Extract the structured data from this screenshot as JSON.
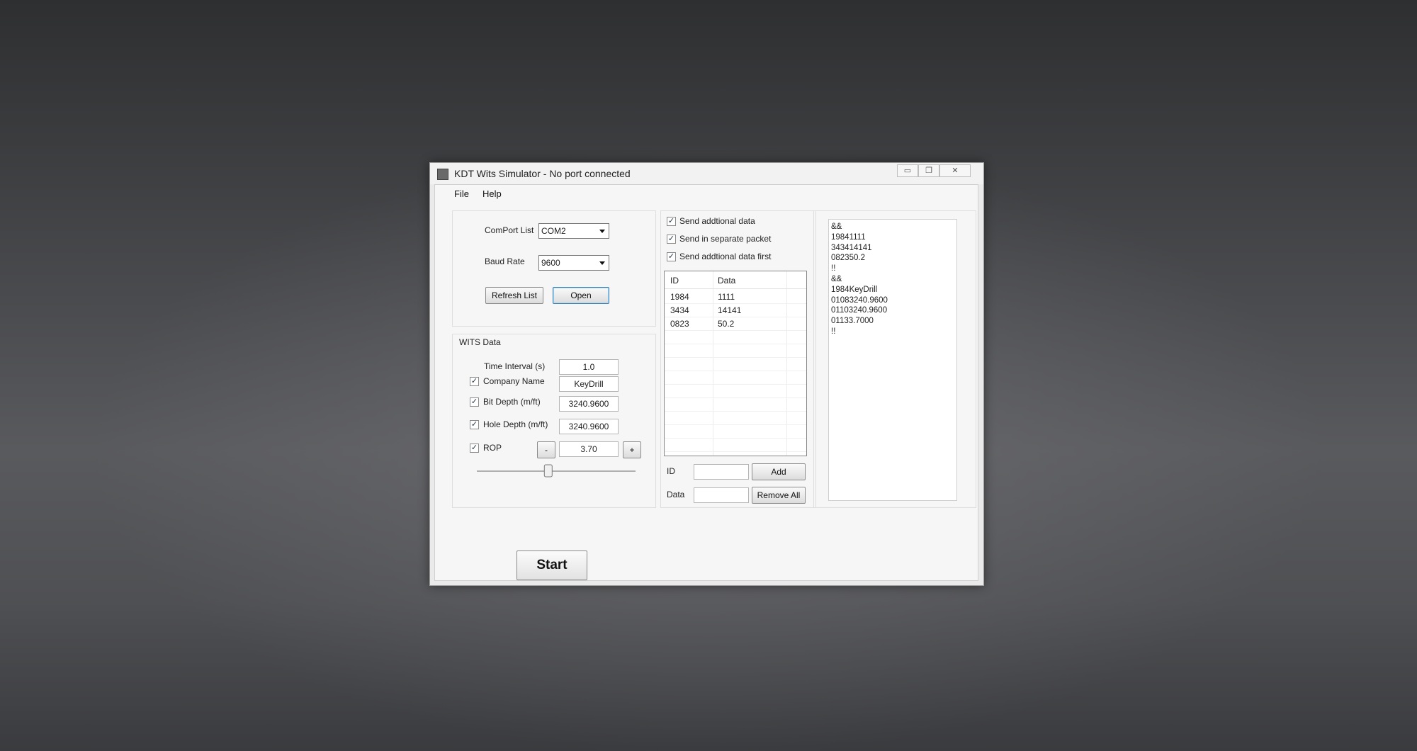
{
  "window": {
    "title": "KDT Wits Simulator - No port connected"
  },
  "menu": {
    "file": "File",
    "help": "Help"
  },
  "connection": {
    "comport_label": "ComPort List",
    "comport_value": "COM2",
    "baud_label": "Baud Rate",
    "baud_value": "9600",
    "refresh_label": "Refresh List",
    "open_label": "Open"
  },
  "wits": {
    "group_title": "WITS Data",
    "interval_label": "Time Interval (s)",
    "interval_value": "1.0",
    "company_label": "Company Name",
    "company_value": "KeyDrill",
    "bitdepth_label": "Bit Depth (m/ft)",
    "bitdepth_value": "3240.9600",
    "holedepth_label": "Hole Depth (m/ft)",
    "holedepth_value": "3240.9600",
    "rop_label": "ROP",
    "rop_value": "3.70",
    "minus_label": "-",
    "plus_label": "+",
    "rop_slider_fraction": 0.45
  },
  "additional": {
    "send_additional": "Send addtional data",
    "send_separate": "Send in separate packet",
    "send_first": "Send addtional data first",
    "columns": [
      "ID",
      "Data"
    ],
    "rows": [
      {
        "id": "1984",
        "data": "1111"
      },
      {
        "id": "3434",
        "data": "14141"
      },
      {
        "id": "0823",
        "data": "50.2"
      }
    ],
    "id_label": "ID",
    "data_label": "Data",
    "add_label": "Add",
    "remove_all_label": "Remove All"
  },
  "output": {
    "lines": [
      "&&",
      "19841111",
      "343414141",
      "082350.2",
      "!!",
      "&&",
      "1984KeyDrill",
      "01083240.9600",
      "01103240.9600",
      "01133.7000",
      "!!"
    ]
  },
  "start_label": "Start",
  "checkbox_mark": "✓"
}
